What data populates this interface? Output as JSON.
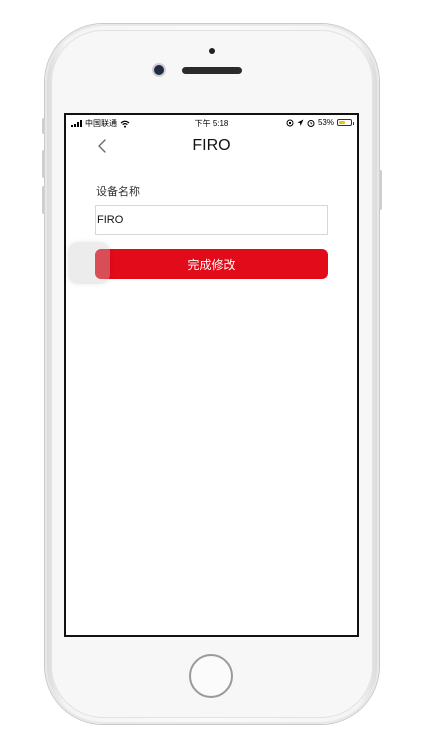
{
  "status_bar": {
    "carrier": "中国联通",
    "time": "下午 5:18",
    "battery": "53%",
    "battery_level": 0.53
  },
  "nav": {
    "title": "FIRO",
    "back_icon": "chevron-left-icon"
  },
  "form": {
    "device_name_label": "设备名称",
    "device_name_value": "FIRO",
    "submit_label": "完成修改"
  },
  "colors": {
    "accent": "#e10b19",
    "battery_fill": "#f2c200"
  }
}
